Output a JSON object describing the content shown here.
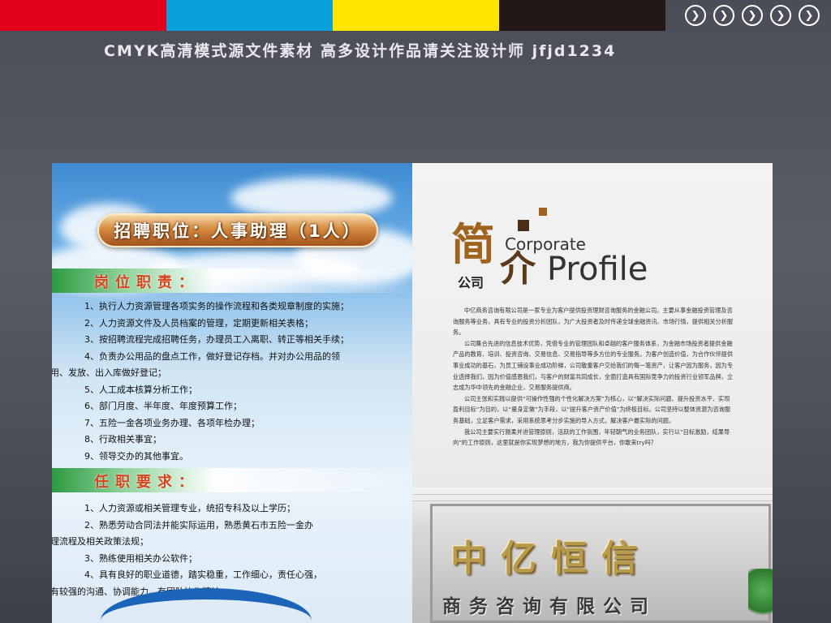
{
  "colors": {
    "cyan": "#0aa0dc",
    "magenta": "#e2001a",
    "yellow": "#ffe400",
    "black": "#231815"
  },
  "banner": {
    "text": "CMYK高清模式源文件素材  高多设计作品请关注设计师 jfjd1234"
  },
  "nav": {
    "icon": "chevron-right-circle-icon",
    "count": 5
  },
  "left": {
    "title": "招聘职位：人事助理（1人）",
    "duties_title": "岗位职责：",
    "duties": [
      "1、执行人力资源管理各项实务的操作流程和各类规章制度的实施；",
      "2、人力资源文件及人员档案的管理，定期更新相关表格；",
      "3、按招聘流程完成招聘任务，办理员工入离职、转正等相关手续；",
      "4、负责办公用品的盘点工作，做好登记存档。并对办公用品的领",
      "用、发放、出入库做好登记；",
      "5、人工成本核算分析工作；",
      "6、部门月度、半年度、年度预算工作；",
      "7、五险一金各项业务办理、各项年检办理；",
      "8、行政相关事宜；",
      "9、领导交办的其他事宜。"
    ],
    "req_title": "任职要求：",
    "requirements": [
      "1、人力资源或相关管理专业，统招专科及以上学历；",
      "2、熟悉劳动合同法并能实际运用，熟悉黄石市五险一金办",
      "理流程及相关政策法规；",
      "3、熟练使用相关办公软件；",
      "4、具有良好的职业道德，踏实稳重，工作细心，责任心强，",
      "有较强的沟通、协调能力，有团队协作精神。"
    ]
  },
  "right": {
    "logo": {
      "jian": "简",
      "jie": "介",
      "company": "公司",
      "corporate": "Corporate",
      "profile": "Profile"
    },
    "paragraphs": [
      "中亿商务咨询有限公司是一家专业为客户提供投资理财咨询服务的金融公司。主要从事金融投资管理及咨询服务等业务，具有专业的投资分析团队，为广大投资者及时传递全球金融资讯、市场行情，提供相关分析服务。",
      "公司集合先进的信息技术优势，凭借专业的管理团队和卓越的客户服务体系，为金融市场投资者提供金融产品的教育、培训、投资咨询、交易信息、交易指导等多方位的专业服务。为客户创造价值，为合作伙伴提供事业成功的基石，为员工铺设事业成功阶梯，公司敬重客户交给我们的每一笔资产，让客户因为服务，因为专业选择我们，因为价值感恩我们，与客户的财富共同成长，全面打造具有国际竞争力的投资行业领军品牌，立志成为华中领先的金融企业，交易服务提供商。",
      "公司主张和实践以提供“可操作性强的个性化解决方案”为核心，以“解决实际问题、提升投资水平、实现盈利目标”为目的，以“量身定做”为手段，以“提升客户资产价值”为终极目标。公司坚持以整体资源为咨询服务基础，立足客户需求，采用系统思考分步实施的导入方式，解决客户最实际的问题。",
      "我公司主要实行刚柔并进管理原则，活跃的工作氛围，年轻朝气的业务团队，实行以“目标激励，结果导向”的工作原则，这里就是你实现梦想的地方，我为你提供平台，你敢来try吗？"
    ],
    "sign": {
      "big": "中亿恒信",
      "small": "商务咨询有限公司"
    }
  }
}
